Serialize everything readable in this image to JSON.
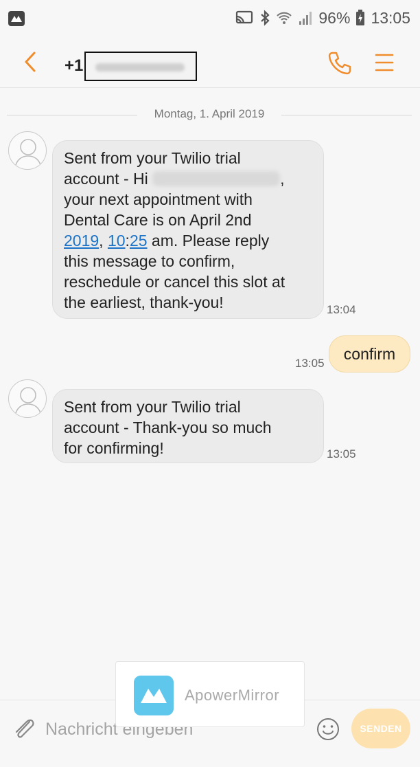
{
  "status_bar": {
    "battery": "96%",
    "time": "13:05"
  },
  "header": {
    "title_prefix": "+1"
  },
  "date_separator": "Montag, 1. April 2019",
  "messages": [
    {
      "direction": "incoming",
      "line1": "Sent from your Twilio trial",
      "line2_start": "account - Hi",
      "line2_end": ",",
      "line3": "your next appointment with",
      "line4": "Dental Care is on April 2nd",
      "line5_link1": "2019",
      "line5_sep1": ", ",
      "line5_link2": "10",
      "line5_colon": ":",
      "line5_link3": "25",
      "line5_rest": " am. Please reply",
      "line6": "this message to confirm,",
      "line7": "reschedule or cancel this slot at",
      "line8": "the earliest, thank-you!",
      "time": "13:04"
    },
    {
      "direction": "outgoing",
      "text": "confirm",
      "time": "13:05"
    },
    {
      "direction": "incoming",
      "line1": "Sent from your Twilio trial",
      "line2": "account - Thank-you so much",
      "line3": "for confirming!",
      "time": "13:05"
    }
  ],
  "watermark": {
    "text": "ApowerMirror"
  },
  "composer": {
    "placeholder": "Nachricht eingeben",
    "send_label": "SENDEN"
  },
  "colors": {
    "accent": "#f08c2b",
    "link": "#1a73c8",
    "incoming_bubble": "#ebebeb",
    "outgoing_bubble": "#fde9c2",
    "send_button": "#fde2b0"
  }
}
